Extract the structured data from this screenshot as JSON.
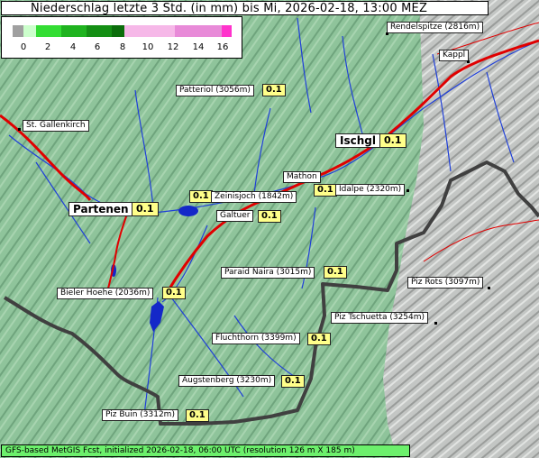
{
  "title": "Niederschlag letzte 3 Std. (in mm) bis Mi, 2026-02-18, 13:00 MEZ",
  "legend": {
    "ticks": [
      "0",
      "2",
      "4",
      "6",
      "8",
      "10",
      "12",
      "14",
      "16"
    ],
    "colors": {
      "below_zero": "#a0a0a0",
      "zero": "#ccffcc",
      "low": "#33cc33",
      "mid": "#1a9a1a",
      "dark": "#0b6e0b",
      "light_pink": "#f0a8e0",
      "pink": "#e070d0",
      "top": "#ff33cc"
    }
  },
  "places": [
    {
      "name": "Rendelspitze (2816m)"
    },
    {
      "name": "Kappl"
    },
    {
      "name": "Patteriol (3056m)",
      "value": "0.1"
    },
    {
      "name": "St. Gallenkirch"
    },
    {
      "name": "Ischgl",
      "value": "0.1"
    },
    {
      "name": "Mathon"
    },
    {
      "name": "Idalpe (2320m)",
      "value": "0.1"
    },
    {
      "name": "Zeinisjoch (1842m)",
      "value": "0.1"
    },
    {
      "name": "Partenen",
      "value": "0.1"
    },
    {
      "name": "Galtuer",
      "value": "0.1"
    },
    {
      "name": "Paraid Naira (3015m)",
      "value": "0.1"
    },
    {
      "name": "Piz Rots (3097m)"
    },
    {
      "name": "Bieler Hoehe (2036m)",
      "value": "0.1"
    },
    {
      "name": "Piz Tschuetta (3254m)"
    },
    {
      "name": "Fluchthorn (3399m)",
      "value": "0.1"
    },
    {
      "name": "Augstenberg (3230m)",
      "value": "0.1"
    },
    {
      "name": "Piz Buin (3312m)",
      "value": "0.1"
    }
  ],
  "footer": "GFS-based MetGIS Fcst, initialized 2026-02-18, 06:00 UTC  (resolution 126 m X 185 m)",
  "map_colors": {
    "terrain": "#8fc49b",
    "out_of_region": "#c8c8c8",
    "rivers": "#1f3fd8",
    "roads": "#e00000",
    "border": "#404040",
    "lakes": "#1428c8"
  }
}
